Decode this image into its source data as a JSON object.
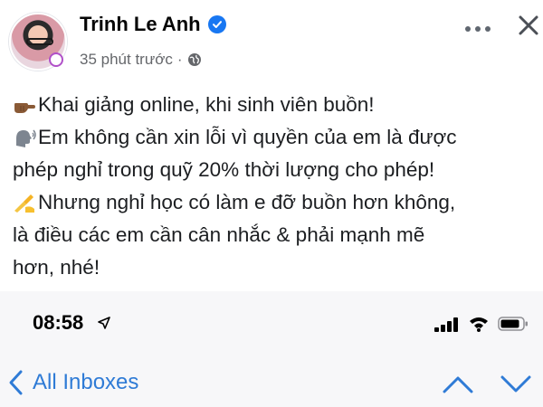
{
  "post": {
    "author": "Trinh Le Anh",
    "timestamp": "35 phút trước",
    "separator": "·",
    "verified_icon": "verified-badge-icon",
    "audience_icon": "globe-icon",
    "lines": [
      {
        "emoji": "backhand-pointing-right-emoji",
        "text": "Khai giảng online, khi sinh viên buồn!"
      },
      {
        "emoji": "speaking-head-emoji",
        "text": "Em không cần xin lỗi vì quyền của em là được"
      },
      {
        "emoji": "",
        "text": "phép nghỉ trong quỹ 20% thời lượng cho phép!"
      },
      {
        "emoji": "writing-hand-emoji",
        "text": "Nhưng nghỉ học có làm e đỡ buồn hơn không,"
      },
      {
        "emoji": "",
        "text": "là điều các em cần cân nhắc & phải mạnh mẽ"
      },
      {
        "emoji": "",
        "text": "hơn, nhé!"
      }
    ]
  },
  "phone": {
    "status": {
      "time": "08:58",
      "location_icon": "location-arrow-icon",
      "signal_icon": "cellular-signal-icon",
      "wifi_icon": "wifi-icon",
      "battery_icon": "battery-icon"
    },
    "nav": {
      "back_label": "All Inboxes",
      "prev_icon": "chevron-up-icon",
      "next_icon": "chevron-down-icon"
    }
  },
  "colors": {
    "link_blue": "#2f7bd6",
    "verified_blue": "#1877f2",
    "meta_gray": "#65676b",
    "phone_bg": "#f7f7f9"
  }
}
